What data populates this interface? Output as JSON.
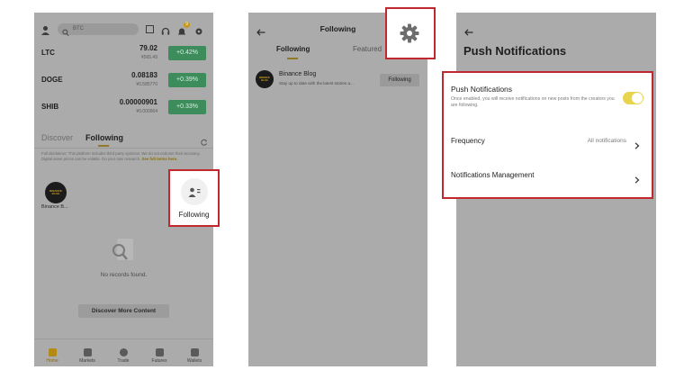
{
  "screen1": {
    "search_placeholder": "BTC",
    "notif_badge": "9",
    "market_rows": [
      {
        "coin": "LTC",
        "price": "79.02",
        "sub": "¥565.49",
        "change": "+0.42%"
      },
      {
        "coin": "DOGE",
        "price": "0.08183",
        "sub": "¥0.585770",
        "change": "+0.39%"
      },
      {
        "coin": "SHIB",
        "price": "0.00000901",
        "sub": "¥0.000064",
        "change": "+0.33%"
      }
    ],
    "tabs": {
      "discover": "Discover",
      "following": "Following"
    },
    "disclaimer": "Full disclaimer: This platform includes third party opinions. We do not endorse their accuracy. Digital asset prices can be volatile. Do your own research.",
    "disclaimer_link": "See full terms here.",
    "avatar_logo_text": "BINANCE BLOG",
    "avatar_label": "Binance B...",
    "empty_text": "No records found.",
    "discover_more": "Discover More Content",
    "bottom_nav": [
      "Home",
      "Markets",
      "Trade",
      "Futures",
      "Wallets"
    ],
    "callout_label": "Following"
  },
  "screen2": {
    "title": "Following",
    "tabs": {
      "following": "Following",
      "featured": "Featured"
    },
    "item": {
      "name": "Binance Blog",
      "desc": "Stay up to date with the latest stories a...",
      "button": "Following",
      "logo_text": "BINANCE BLOG"
    }
  },
  "screen3": {
    "title": "Push Notifications",
    "toggle_label": "Push Notifications",
    "toggle_desc": "Once enabled, you will receive notifications on new posts from the creators you are following.",
    "frequency_label": "Frequency",
    "frequency_value": "All notifications",
    "management_label": "Notifications Management"
  },
  "colors": {
    "overlay_gray": "#ababab",
    "highlight_red": "#c0282d",
    "accent_yellow": "#f0b90b",
    "toggle_yellow": "#e8d44d",
    "positive_green": "#3c8c5c"
  }
}
